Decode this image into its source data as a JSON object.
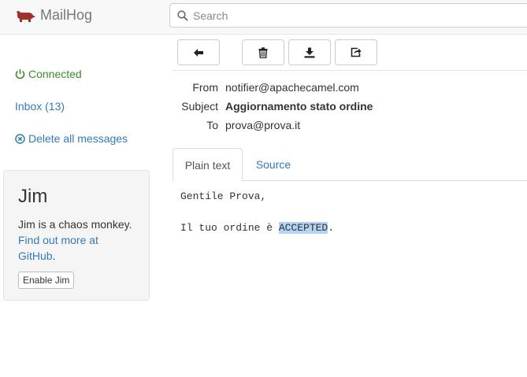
{
  "navbar": {
    "brand_icon": "pig-icon",
    "brand_color": "#a0302a",
    "brand_text": "MailHog",
    "search_placeholder": "Search"
  },
  "sidebar": {
    "connected_label": "Connected",
    "connected_color": "#3c8a2e",
    "inbox_label": "Inbox (13)",
    "delete_label": "Delete all messages"
  },
  "jim": {
    "title": "Jim",
    "desc": "Jim is a chaos monkey.",
    "link": "Find out more at GitHub",
    "link_suffix": ".",
    "button": "Enable Jim"
  },
  "toolbar": {
    "buttons": [
      "back-arrow-icon",
      "trash-icon",
      "download-icon",
      "release-icon"
    ]
  },
  "headers": {
    "from_label": "From",
    "from_value": "notifier@apachecamel.com",
    "subject_label": "Subject",
    "subject_value": "Aggiornamento stato ordine",
    "to_label": "To",
    "to_value": "prova@prova.it"
  },
  "tabs": {
    "plain": "Plain text",
    "source": "Source"
  },
  "message": {
    "line1": "Gentile Prova,",
    "line2_prefix": "Il tuo ordine è ",
    "line2_highlight": "ACCEPTED",
    "line2_suffix": "."
  }
}
